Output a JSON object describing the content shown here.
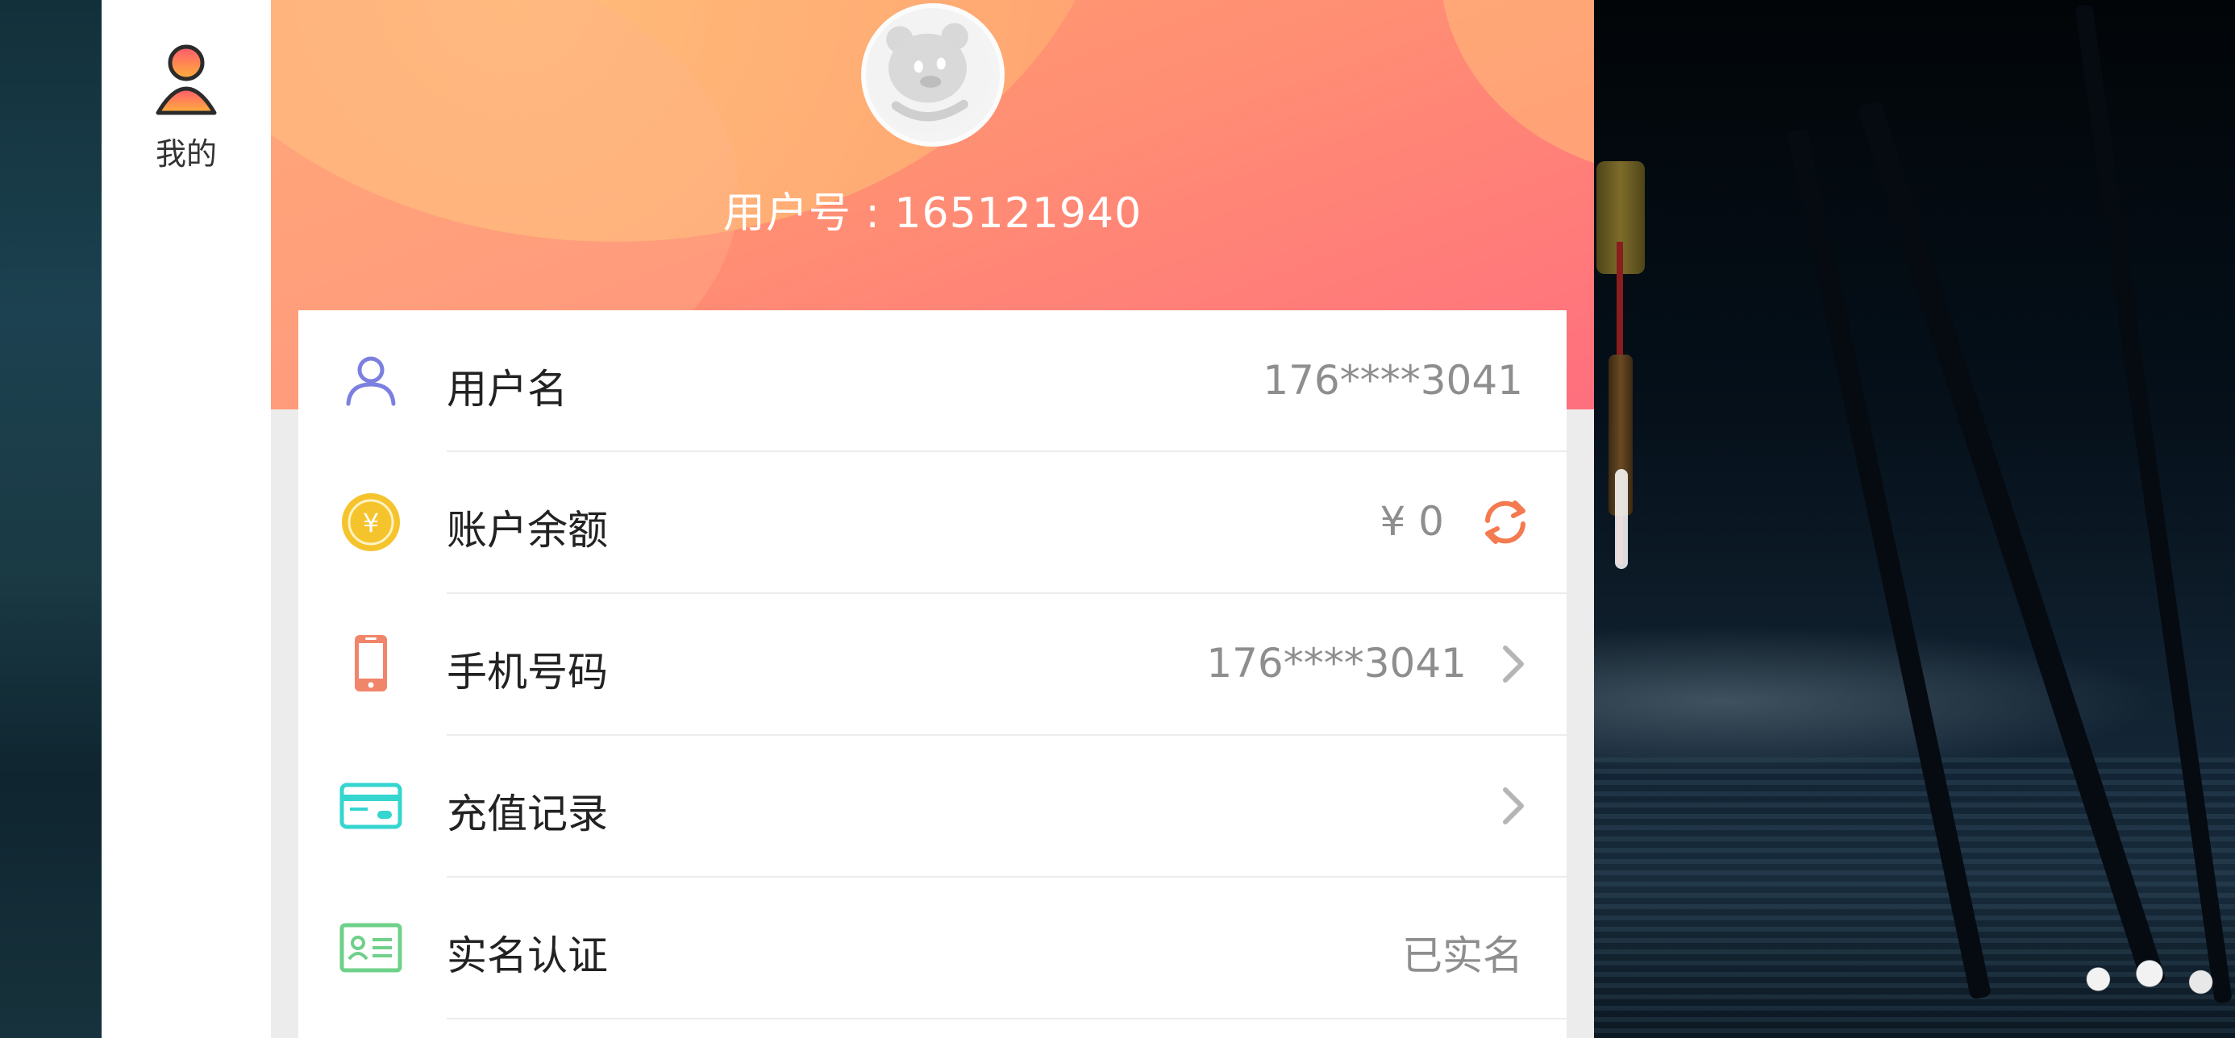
{
  "nav": {
    "mine_label": "我的"
  },
  "header": {
    "user_number": "用户号 : 165121940"
  },
  "rows": [
    {
      "label": "用户名",
      "value": "176****3041",
      "icon": "user-icon"
    },
    {
      "label": "账户余额",
      "value": "¥ 0",
      "icon": "coin-icon"
    },
    {
      "label": "手机号码",
      "value": "176****3041",
      "icon": "phone-icon"
    },
    {
      "label": "充值记录",
      "value": "",
      "icon": "credit-card-icon"
    },
    {
      "label": "实名认证",
      "value": "已实名",
      "icon": "id-card-icon"
    }
  ],
  "colors": {
    "accent_orange": "#f47a4f",
    "header_start": "#ffa26f",
    "header_end": "#ff6f7e",
    "user_icon": "#7b80e0",
    "coin_icon": "#f5c32c",
    "phone_icon": "#f0856a",
    "card_icon": "#35d5d0",
    "id_icon": "#6fd08a"
  }
}
